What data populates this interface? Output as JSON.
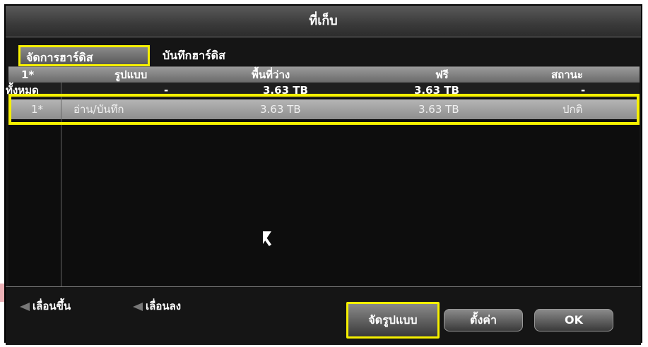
{
  "window": {
    "title": "ที่เก็บ"
  },
  "tabs": [
    {
      "label": "จัดการฮาร์ดิส",
      "active": true
    },
    {
      "label": "บันทึกฮาร์ดิส",
      "active": false
    }
  ],
  "table": {
    "headers": [
      "1*",
      "รูปแบบ",
      "พื้นที่ว่าง",
      "ฟรี",
      "สถานะ"
    ],
    "rows": [
      {
        "label": "ทั้งหมด",
        "type": "-",
        "capacity": "3.63 TB",
        "free": "3.63 TB",
        "status": "-"
      },
      {
        "label": "1*",
        "type": "อ่าน/บันทึก",
        "capacity": "3.63 TB",
        "free": "3.63 TB",
        "status": "ปกติ"
      }
    ]
  },
  "footer": {
    "scroll_up": "เลื่อนขึ้น",
    "scroll_down": "เลื่อนลง",
    "format_button": "จัดรูปแบบ",
    "settings_button": "ตั้งค่า",
    "ok_button": "OK"
  },
  "colors": {
    "highlight": "#f6f000",
    "panel": "#151515",
    "selected_row": "#a0a0a0"
  }
}
